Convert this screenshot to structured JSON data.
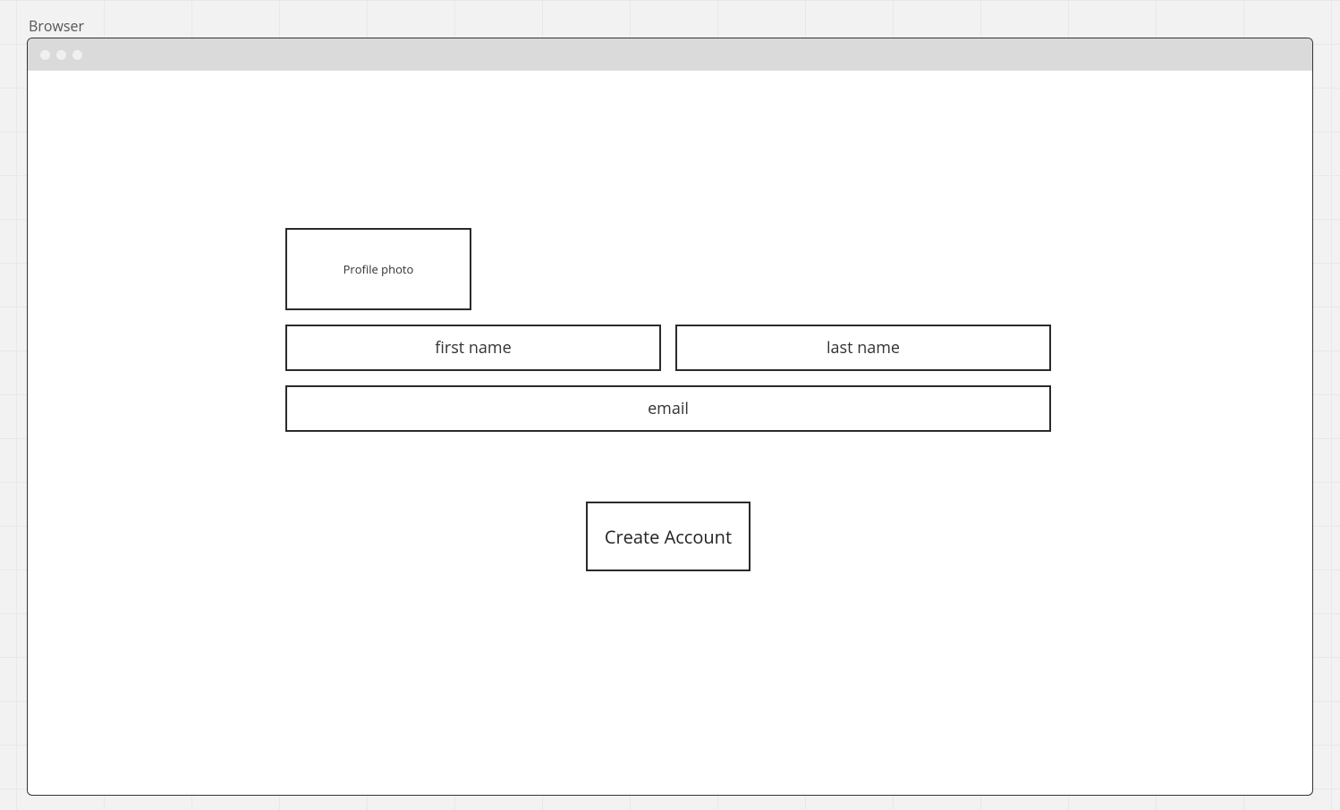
{
  "canvas": {
    "tab_label": "Browser"
  },
  "form": {
    "profile_photo_label": "Profile photo",
    "first_name_placeholder": "first name",
    "last_name_placeholder": "last name",
    "email_placeholder": "email",
    "submit_label": "Create Account"
  }
}
